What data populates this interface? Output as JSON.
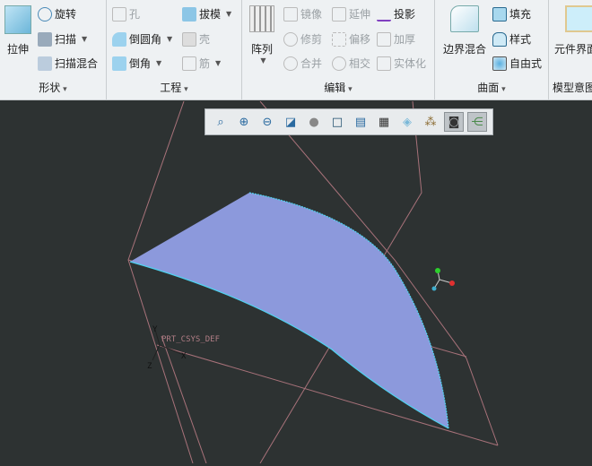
{
  "ribbon": {
    "shape": {
      "label": "形状",
      "extrude": "拉伸",
      "revolve": "旋转",
      "sweep": "扫描",
      "swept_blend": "扫描混合"
    },
    "engineering": {
      "label": "工程",
      "hole": "孔",
      "draft": "拔模",
      "round": "倒圆角",
      "shell": "壳",
      "chamfer": "倒角",
      "rib": "筋"
    },
    "editing": {
      "label": "编辑",
      "pattern": "阵列",
      "mirror": "镜像",
      "extend": "延伸",
      "project": "投影",
      "trim": "修剪",
      "offset": "偏移",
      "thicken": "加厚",
      "merge": "合并",
      "intersect": "相交",
      "solidify": "实体化"
    },
    "surfaces": {
      "label": "曲面",
      "boundary_blend": "边界混合",
      "fill": "填充",
      "style": "样式",
      "freestyle": "自由式"
    },
    "model_intent": {
      "label": "模型意图",
      "component_interface": "元件界面"
    }
  },
  "view_toolbar": {
    "icons": [
      "refit-icon",
      "zoom-in-icon",
      "zoom-out-icon",
      "repaint-icon",
      "display-style-icon",
      "saved-orientations-icon",
      "view-manager-icon",
      "perspective-view-icon",
      "spin-center-icon",
      "datum-display-icon",
      "annotation-display-icon",
      "csys-display-icon"
    ]
  },
  "viewport": {
    "csys_label": "PRT_CSYS_DEF",
    "axis_x": "X",
    "axis_y": "Y",
    "axis_z": "Z",
    "surface_color": "#8c99dc",
    "edge_color": "#4fd2f0",
    "datum_color": "#a8727a",
    "background": "#2d3232"
  }
}
